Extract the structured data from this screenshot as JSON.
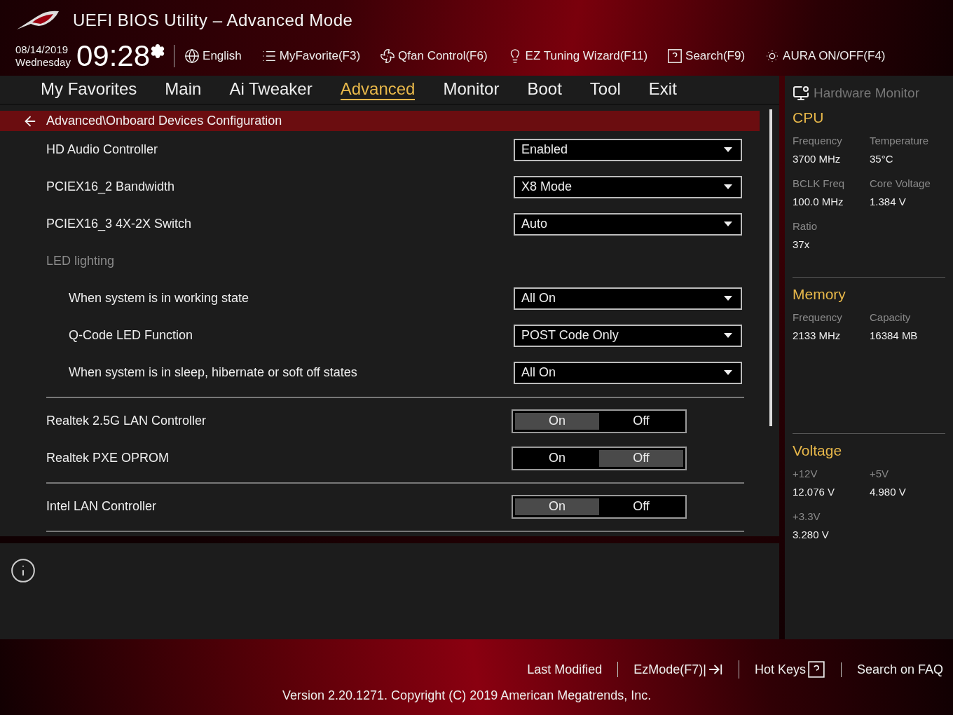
{
  "window": {
    "title": "UEFI BIOS Utility – Advanced Mode"
  },
  "clock": {
    "date": "08/14/2019",
    "day": "Wednesday",
    "time": "09:28"
  },
  "toolbar": [
    {
      "kind": "globe",
      "label": "English"
    },
    {
      "kind": "list",
      "label": "MyFavorite(F3)"
    },
    {
      "kind": "fan",
      "label": "Qfan Control(F6)"
    },
    {
      "kind": "bulb",
      "label": "EZ Tuning Wizard(F11)"
    },
    {
      "kind": "help",
      "label": "Search(F9)"
    },
    {
      "kind": "aura",
      "label": "AURA ON/OFF(F4)"
    }
  ],
  "tabs": [
    {
      "label": "My Favorites",
      "selected": false
    },
    {
      "label": "Main",
      "selected": false
    },
    {
      "label": "Ai Tweaker",
      "selected": false
    },
    {
      "label": "Advanced",
      "selected": true
    },
    {
      "label": "Monitor",
      "selected": false
    },
    {
      "label": "Boot",
      "selected": false
    },
    {
      "label": "Tool",
      "selected": false
    },
    {
      "label": "Exit",
      "selected": false
    }
  ],
  "breadcrumb": "Advanced\\Onboard Devices Configuration",
  "groups": [
    [
      {
        "kind": "dropdown",
        "label": "HD Audio Controller",
        "value": "Enabled"
      },
      {
        "kind": "dropdown",
        "label": "PCIEX16_2 Bandwidth",
        "value": "X8 Mode"
      },
      {
        "kind": "dropdown",
        "label": "PCIEX16_3 4X-2X Switch",
        "value": "Auto"
      },
      {
        "kind": "section",
        "label": "LED lighting",
        "children": [
          {
            "kind": "dropdown",
            "label": "When system is in working state",
            "value": "All On"
          },
          {
            "kind": "dropdown",
            "label": "Q-Code LED Function",
            "value": "POST Code Only"
          },
          {
            "kind": "dropdown",
            "label": "When system is in sleep, hibernate or soft off states",
            "value": "All On"
          }
        ]
      }
    ],
    [
      {
        "kind": "toggle",
        "label": "Realtek 2.5G LAN Controller",
        "on_label": "On",
        "off_label": "Off",
        "on": true
      },
      {
        "kind": "toggle",
        "label": "Realtek PXE OPROM",
        "on_label": "On",
        "off_label": "Off",
        "on": false
      }
    ],
    [
      {
        "kind": "toggle",
        "label": "Intel LAN Controller",
        "on_label": "On",
        "off_label": "Off",
        "on": true
      }
    ]
  ],
  "monitor": {
    "title": "Hardware Monitor",
    "sections": [
      {
        "title": "CPU",
        "rows": [
          [
            {
              "label": "Frequency",
              "value": "3700 MHz"
            },
            {
              "label": "Temperature",
              "value": "35°C"
            }
          ],
          [
            {
              "label": "BCLK Freq",
              "value": "100.0 MHz"
            },
            {
              "label": "Core Voltage",
              "value": "1.384 V"
            }
          ],
          [
            {
              "label": "Ratio",
              "value": "37x"
            }
          ]
        ]
      },
      {
        "title": "Memory",
        "rows": [
          [
            {
              "label": "Frequency",
              "value": "2133 MHz"
            },
            {
              "label": "Capacity",
              "value": "16384 MB"
            }
          ]
        ]
      },
      {
        "title": "Voltage",
        "rows": [
          [
            {
              "label": "+12V",
              "value": "12.076 V"
            },
            {
              "label": "+5V",
              "value": "4.980 V"
            }
          ],
          [
            {
              "label": "+3.3V",
              "value": "3.280 V"
            }
          ]
        ]
      }
    ]
  },
  "footer": {
    "links": [
      {
        "kind": "text",
        "label": "Last Modified"
      },
      {
        "kind": "exit",
        "label": "EzMode(F7)|"
      },
      {
        "kind": "help",
        "label": "Hot Keys"
      },
      {
        "kind": "text",
        "label": "Search on FAQ"
      }
    ],
    "version": "Version 2.20.1271. Copyright (C) 2019 American Megatrends, Inc."
  }
}
